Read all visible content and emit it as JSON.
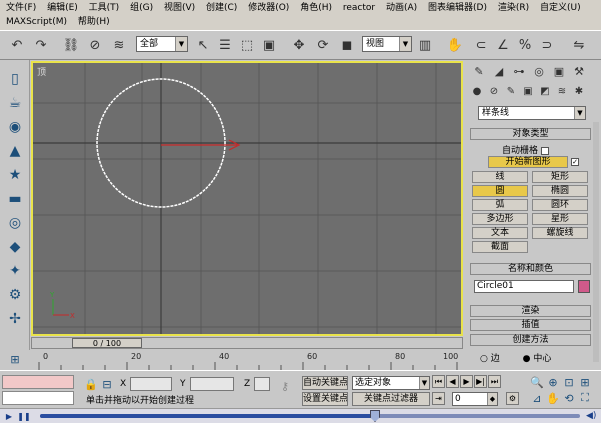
{
  "menu": {
    "row1": [
      "文件(F)",
      "编辑(E)",
      "工具(T)",
      "组(G)",
      "视图(V)",
      "创建(C)",
      "修改器(O)",
      "角色(H)",
      "reactor",
      "动画(A)",
      "图表编辑器(D)",
      "渲染(R)",
      "自定义(U)"
    ],
    "row2": [
      "MAXScript(M)",
      "帮助(H)"
    ]
  },
  "toolbar": {
    "selection_filter": "全部",
    "reference_coord": "视图"
  },
  "left_tools": [
    "cylinder-icon",
    "sphere-icon",
    "cone-icon",
    "star-icon",
    "box-icon",
    "tube-icon",
    "plane-icon",
    "light-icon",
    "gear-icon",
    "helper-icon",
    "camera-icon"
  ],
  "viewport": {
    "label": "顶",
    "grid_color": "#5a5a5a",
    "bg_color": "#6e6e6e",
    "active_border_color": "#e9e34a"
  },
  "command_panel": {
    "category_dropdown": "样条线",
    "object_type_title": "对象类型",
    "auto_grid_label": "自动栅格",
    "start_new_shape_label": "开始新图形",
    "start_new_shape_checked": true,
    "buttons": [
      {
        "label": "线",
        "active": false
      },
      {
        "label": "矩形",
        "active": false
      },
      {
        "label": "圆",
        "active": true
      },
      {
        "label": "椭圆",
        "active": false
      },
      {
        "label": "弧",
        "active": false
      },
      {
        "label": "圆环",
        "active": false
      },
      {
        "label": "多边形",
        "active": false
      },
      {
        "label": "星形",
        "active": false
      },
      {
        "label": "文本",
        "active": false
      },
      {
        "label": "螺旋线",
        "active": false
      },
      {
        "label": "截面",
        "active": false
      }
    ],
    "name_color_title": "名称和颜色",
    "object_name": "Circle01",
    "object_color": "#d05a8a",
    "rollouts": [
      "渲染",
      "插值",
      "创建方法"
    ],
    "radio_options": [
      "边",
      "中心"
    ]
  },
  "timeline": {
    "slider_text": "0 / 100",
    "ticks": [
      "0",
      "20",
      "40",
      "60",
      "80",
      "100"
    ]
  },
  "status": {
    "x_label": "X",
    "y_label": "Y",
    "z_label": "Z",
    "prompt": "单击并拖动以开始创建过程",
    "auto_key": "自动关键点",
    "selected_object": "选定对象",
    "set_key": "设置关键点",
    "key_filters": "关键点过滤器",
    "frame": "0"
  }
}
